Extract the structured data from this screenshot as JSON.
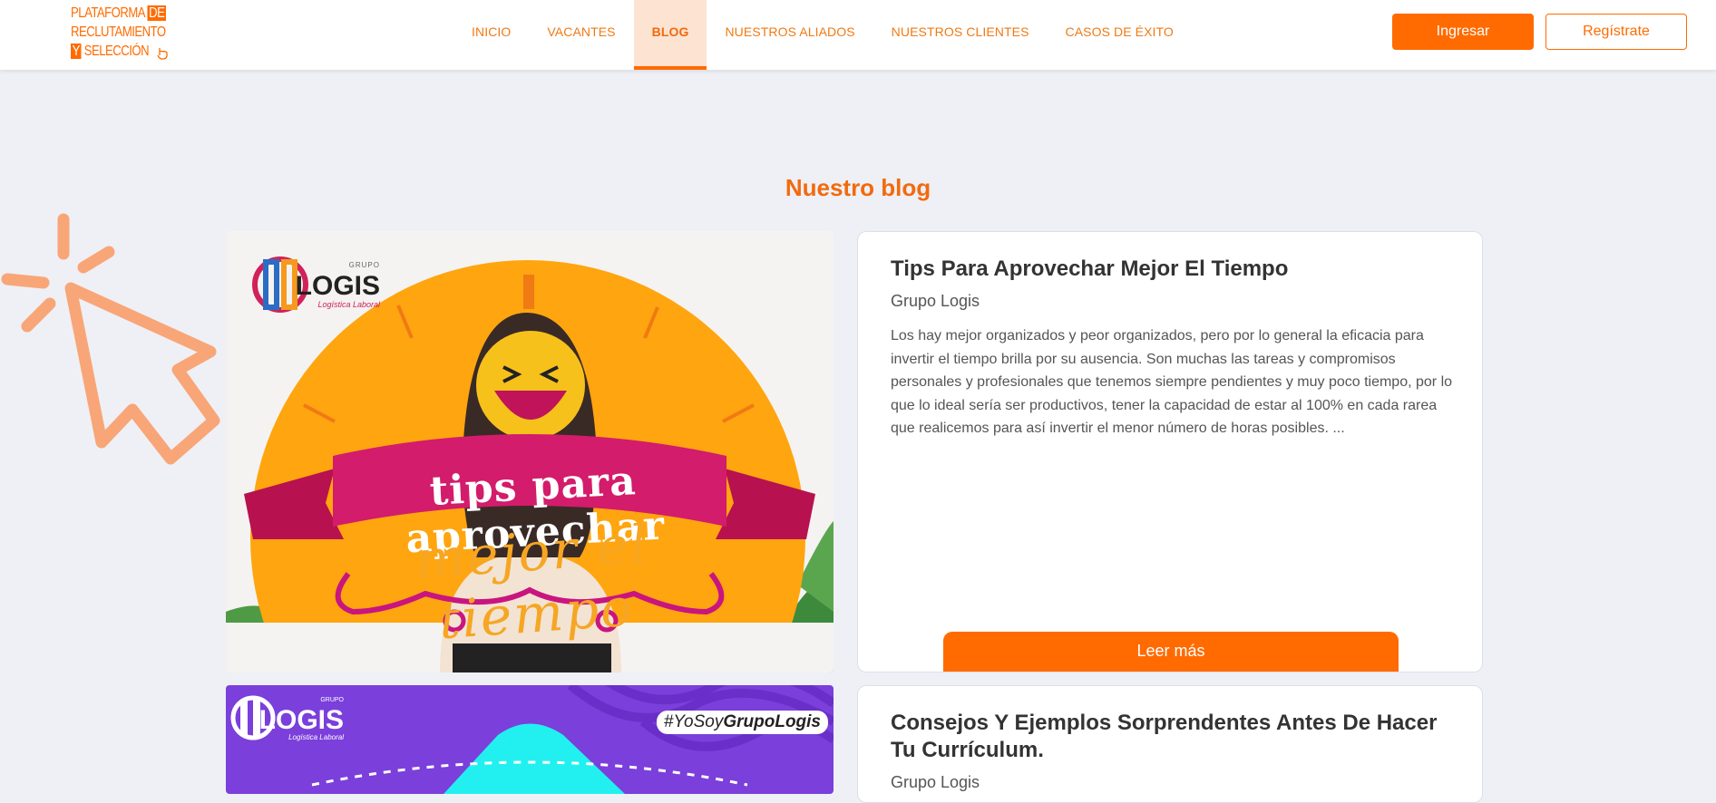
{
  "header": {
    "logo": {
      "line1": "PLATAFORMA",
      "line1_box": "DE",
      "line2": "RECLUTAMIENTO",
      "line3_box": "Y",
      "line3": "SELECCIÓN"
    },
    "nav": [
      {
        "label": "INICIO",
        "active": false
      },
      {
        "label": "VACANTES",
        "active": false
      },
      {
        "label": "BLOG",
        "active": true
      },
      {
        "label": "NUESTROS ALIADOS",
        "active": false
      },
      {
        "label": "NUESTROS CLIENTES",
        "active": false
      },
      {
        "label": "CASOS DE ÉXITO",
        "active": false
      }
    ],
    "login_label": "Ingresar",
    "register_label": "Regístrate"
  },
  "section_title": "Nuestro blog",
  "posts": [
    {
      "title": "Tips Para Aprovechar Mejor El Tiempo",
      "author": "Grupo Logis",
      "excerpt": "Los hay mejor organizados y peor organizados, pero por lo general la eficacia para invertir el tiempo brilla por su ausencia. Son muchas las tareas y compromisos personales y profesionales que tenemos siempre pendientes y muy poco tiempo, por lo que lo ideal sería ser productivos, tener la capacidad de estar al 100% en cada rarea que realicemos para así invertir el menor número de horas posibles. ...",
      "read_more": "Leer más",
      "image": {
        "logo_small": "GRUPO",
        "logo_big": "LOGIS",
        "logo_sub": "Logística Laboral",
        "banner_text": "tips para aprovechar",
        "script_text": "mejor el tiempo"
      }
    },
    {
      "title": "Consejos Y Ejemplos Sorprendentes Antes De Hacer Tu Currículum.",
      "author": "Grupo Logis",
      "image": {
        "logo_small": "GRUPO",
        "logo_big": "LOGIS",
        "logo_sub": "Logística Laboral",
        "hashtag_prefix": "#YoSoy",
        "hashtag_bold": "GrupoLogis"
      }
    }
  ],
  "colors": {
    "brand_orange": "#ff6b00",
    "nav_active_bg": "#fde3d2",
    "page_bg": "#eef0f5",
    "purple": "#7b3fdb",
    "cyan": "#22f0f0"
  }
}
